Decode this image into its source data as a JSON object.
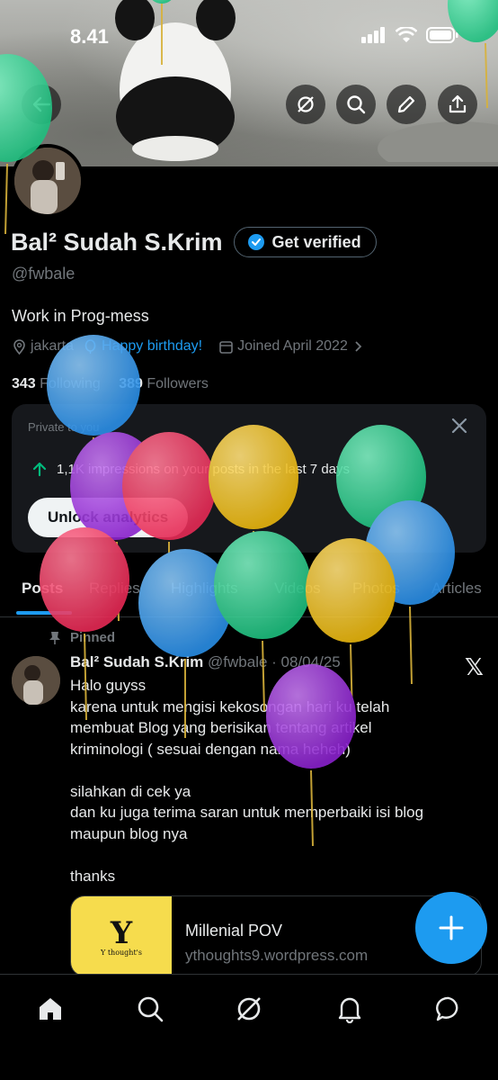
{
  "status": {
    "time": "8.41"
  },
  "profile": {
    "name": "Bal² Sudah S.Krim",
    "verify_label": "Get verified",
    "handle": "@fwbale",
    "bio": "Work in Prog-mess",
    "location": "jakarta",
    "birthday": "Happy birthday!",
    "joined": "Joined April 2022",
    "following_count": "343",
    "following_label": "Following",
    "followers_count": "389",
    "followers_label": "Followers"
  },
  "analytics": {
    "private_label": "Private to you",
    "impressions": "1,1K impressions on your posts in the last 7 days",
    "unlock_label": "Unlock analytics"
  },
  "tabs": [
    {
      "label": "Posts"
    },
    {
      "label": "Replies"
    },
    {
      "label": "Highlights"
    },
    {
      "label": "Videos"
    },
    {
      "label": "Photos"
    },
    {
      "label": "Articles"
    }
  ],
  "post": {
    "pinned_label": "Pinned",
    "author": "Bal² Sudah S.Krim",
    "meta": "@fwbale · 08/04/25",
    "lines": [
      "Halo guyss",
      "karena untuk mengisi kekosongan hari ku telah",
      "membuat Blog yang berisikan tentang artikel",
      "kriminologi ( sesuai dengan nama heheh)",
      "",
      "silahkan di cek ya",
      "dan ku juga terima saran untuk memperbaiki isi blog",
      "maupun blog nya",
      "",
      "thanks"
    ],
    "link": {
      "thumb_letter": "Y",
      "thumb_caption": "Y thought's",
      "title": "Millenial POV",
      "domain": "ythoughts9.wordpress.com"
    }
  },
  "colors": {
    "accent": "#1d9bf0",
    "background": "#000000",
    "secondary_text": "#71767b",
    "balloon_green": "#2fd08f",
    "balloon_blue": "#3aa0f0",
    "balloon_purple": "#9b2fd8",
    "balloon_red": "#ef3d64",
    "balloon_yellow": "#f0c326"
  },
  "icons": {
    "nav": [
      "home-icon",
      "search-icon",
      "grok-icon",
      "notifications-icon",
      "messages-icon"
    ],
    "header": [
      "back-icon",
      "grok-icon",
      "search-icon",
      "edit-icon",
      "share-icon"
    ]
  }
}
